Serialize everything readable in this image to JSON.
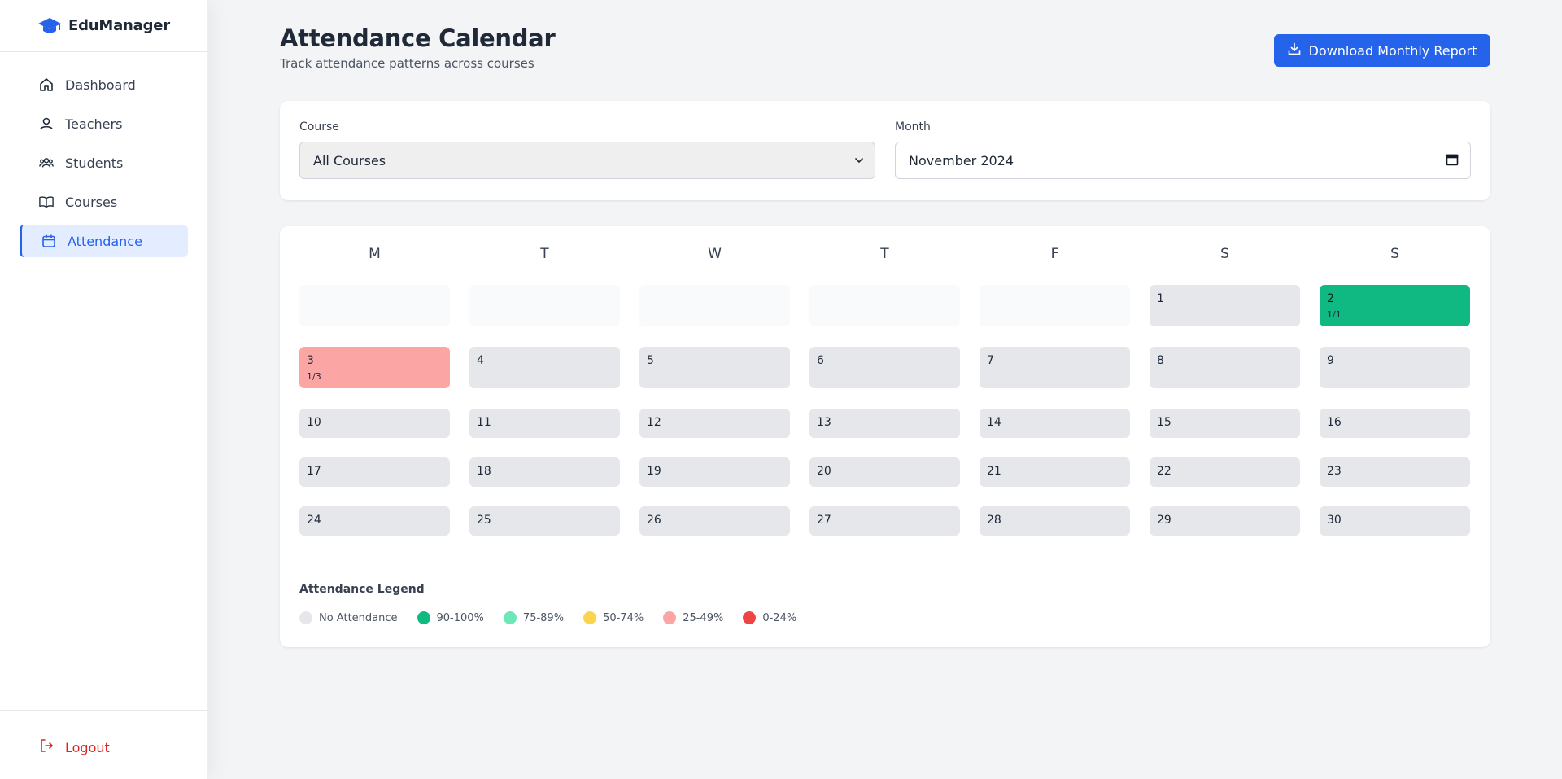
{
  "brand": {
    "name": "EduManager",
    "icon": "graduation-cap-icon"
  },
  "sidebar": {
    "items": [
      {
        "label": "Dashboard",
        "icon": "home-icon"
      },
      {
        "label": "Teachers",
        "icon": "user-icon"
      },
      {
        "label": "Students",
        "icon": "users-icon"
      },
      {
        "label": "Courses",
        "icon": "book-icon"
      },
      {
        "label": "Attendance",
        "icon": "calendar-icon",
        "active": true
      }
    ],
    "logout_label": "Logout"
  },
  "header": {
    "title": "Attendance Calendar",
    "subtitle": "Track attendance patterns across courses",
    "download_label": "Download Monthly Report"
  },
  "filters": {
    "course_label": "Course",
    "course_value": "All Courses",
    "month_label": "Month",
    "month_value": "November 2024"
  },
  "calendar": {
    "weekdays": [
      "M",
      "T",
      "W",
      "T",
      "F",
      "S",
      "S"
    ],
    "weeks": [
      [
        null,
        null,
        null,
        null,
        null,
        {
          "day": "1"
        },
        {
          "day": "2",
          "ratio": "1/1",
          "status": "90-100"
        }
      ],
      [
        {
          "day": "3",
          "ratio": "1/3",
          "status": "25-49"
        },
        {
          "day": "4"
        },
        {
          "day": "5"
        },
        {
          "day": "6"
        },
        {
          "day": "7"
        },
        {
          "day": "8"
        },
        {
          "day": "9"
        }
      ],
      [
        {
          "day": "10"
        },
        {
          "day": "11"
        },
        {
          "day": "12"
        },
        {
          "day": "13"
        },
        {
          "day": "14"
        },
        {
          "day": "15"
        },
        {
          "day": "16"
        }
      ],
      [
        {
          "day": "17"
        },
        {
          "day": "18"
        },
        {
          "day": "19"
        },
        {
          "day": "20"
        },
        {
          "day": "21"
        },
        {
          "day": "22"
        },
        {
          "day": "23"
        }
      ],
      [
        {
          "day": "24"
        },
        {
          "day": "25"
        },
        {
          "day": "26"
        },
        {
          "day": "27"
        },
        {
          "day": "28"
        },
        {
          "day": "29"
        },
        {
          "day": "30"
        }
      ]
    ]
  },
  "legend": {
    "title": "Attendance Legend",
    "items": [
      {
        "label": "No Attendance",
        "color": "#e5e7eb"
      },
      {
        "label": "90-100%",
        "color": "#10b981"
      },
      {
        "label": "75-89%",
        "color": "#6ee7b7"
      },
      {
        "label": "50-74%",
        "color": "#fcd34d"
      },
      {
        "label": "25-49%",
        "color": "#fca5a5"
      },
      {
        "label": "0-24%",
        "color": "#ef4444"
      }
    ]
  },
  "colors": {
    "accent": "#2563eb",
    "danger": "#dc2626"
  }
}
